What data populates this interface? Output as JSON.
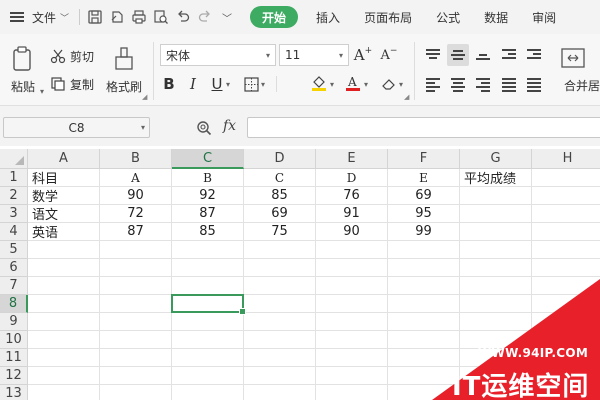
{
  "menubar": {
    "file_label": "文件",
    "tabs": [
      {
        "label": "开始",
        "active": true
      },
      {
        "label": "插入",
        "active": false
      },
      {
        "label": "页面布局",
        "active": false
      },
      {
        "label": "公式",
        "active": false
      },
      {
        "label": "数据",
        "active": false
      },
      {
        "label": "审阅",
        "active": false
      }
    ]
  },
  "ribbon": {
    "paste_label": "粘贴",
    "cut_label": "剪切",
    "copy_label": "复制",
    "format_painter_label": "格式刷",
    "font_name": "宋体",
    "font_size": "11",
    "bold": "B",
    "italic": "I",
    "underline": "U",
    "merge_label": "合并居",
    "accent_color": "#3dab62",
    "font_color": "#e02020",
    "fill_color": "#f5d200"
  },
  "formula_bar": {
    "name_box": "C8",
    "fx_label": "fx",
    "formula_value": ""
  },
  "sheet": {
    "columns": [
      "A",
      "B",
      "C",
      "D",
      "E",
      "F",
      "G",
      "H"
    ],
    "rows": [
      "1",
      "2",
      "3",
      "4",
      "5",
      "6",
      "7",
      "8",
      "9",
      "10",
      "11",
      "12",
      "13"
    ],
    "selected_cell": "C8",
    "cells": {
      "header": [
        "科目",
        "A",
        "B",
        "C",
        "D",
        "E",
        "平均成绩"
      ],
      "r2": [
        "数学",
        "90",
        "92",
        "85",
        "76",
        "69"
      ],
      "r3": [
        "语文",
        "72",
        "87",
        "69",
        "91",
        "95"
      ],
      "r4": [
        "英语",
        "87",
        "85",
        "75",
        "90",
        "99"
      ]
    }
  },
  "watermark": {
    "url": "WWW.94IP.COM",
    "text": "IT运维空间",
    "color": "#e8202a"
  }
}
